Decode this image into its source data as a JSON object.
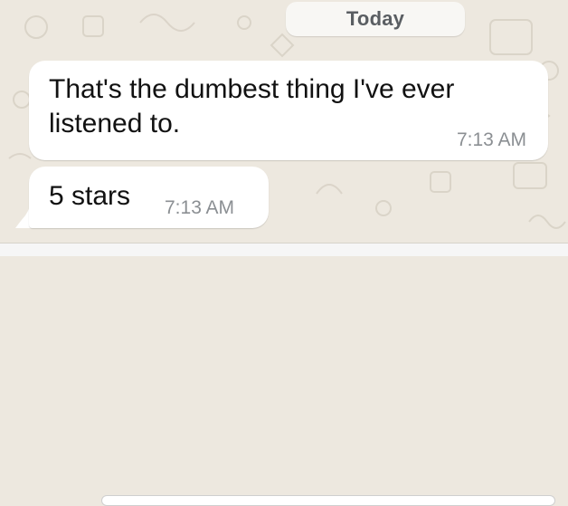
{
  "chat": {
    "date_separator": "Today",
    "messages": [
      {
        "text": "That's the dumbest thing I've ever listened to.",
        "time": "7:13 AM"
      },
      {
        "text": "5 stars",
        "time": "7:13 AM"
      }
    ]
  },
  "colors": {
    "wallpaper": "#ede8df",
    "bubble": "#ffffff",
    "message_text": "#111111",
    "timestamp_text": "#8b8f93",
    "date_pill": "#f8f7f4"
  },
  "icons": {
    "wallpaper_pattern": "doodle-pattern-icon",
    "bubble_tail": "chat-bubble-tail-icon"
  }
}
